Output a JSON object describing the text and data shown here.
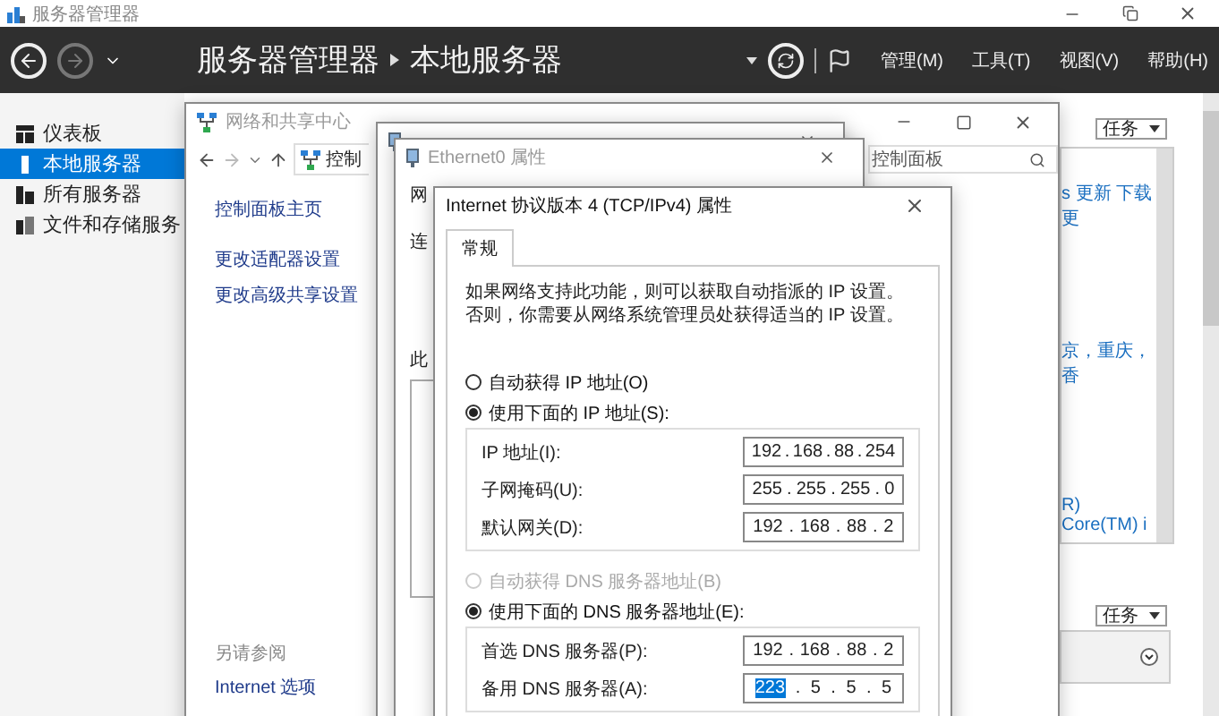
{
  "title_bar": {
    "title": "服务器管理器"
  },
  "header": {
    "breadcrumb": [
      "服务器管理器",
      "本地服务器"
    ],
    "menu": [
      "管理(M)",
      "工具(T)",
      "视图(V)",
      "帮助(H)"
    ]
  },
  "sidebar": {
    "items": [
      {
        "label": "仪表板",
        "selected": false
      },
      {
        "label": "本地服务器",
        "selected": true
      },
      {
        "label": "所有服务器",
        "selected": false
      },
      {
        "label": "文件和存储服务",
        "selected": false
      }
    ]
  },
  "background_panel": {
    "tasks_label": "任务",
    "lines": [
      "s 更新 下载更",
      "京，重庆，香",
      "R) Core(TM) i"
    ],
    "tasks_label_2": "任务"
  },
  "network_window": {
    "title": "网络和共享中心",
    "address": "控制",
    "search": "控制面板",
    "links": [
      "控制面板主页",
      "更改适配器设置",
      "更改高级共享设置"
    ],
    "see_also_heading": "另请参阅",
    "see_also": [
      "Internet 选项"
    ]
  },
  "ethernet_properties_window": {
    "title": "Ethernet0 属性",
    "fragments": [
      "网",
      "连",
      "此"
    ]
  },
  "ipv4_dialog": {
    "title": "Internet 协议版本 4 (TCP/IPv4) 属性",
    "separator": ".",
    "tabs": [
      {
        "label": "常规",
        "selected": true
      }
    ],
    "description": "如果网络支持此功能，则可以获取自动指派的 IP 设置。否则，你需要从网络系统管理员处获得适当的 IP 设置。",
    "ip_options": [
      {
        "label": "自动获得 IP 地址(O)",
        "selected": false,
        "disabled": false
      },
      {
        "label": "使用下面的 IP 地址(S):",
        "selected": true,
        "disabled": false
      }
    ],
    "ip_fields": [
      {
        "label": "IP 地址(I):",
        "octets": [
          {
            "text": "192",
            "selected": false
          },
          {
            "text": "168",
            "selected": false
          },
          {
            "text": "88",
            "selected": false
          },
          {
            "text": "254",
            "selected": false
          }
        ]
      },
      {
        "label": "子网掩码(U):",
        "octets": [
          {
            "text": "255",
            "selected": false
          },
          {
            "text": "255",
            "selected": false
          },
          {
            "text": "255",
            "selected": false
          },
          {
            "text": "0",
            "selected": false
          }
        ]
      },
      {
        "label": "默认网关(D):",
        "octets": [
          {
            "text": "192",
            "selected": false
          },
          {
            "text": "168",
            "selected": false
          },
          {
            "text": "88",
            "selected": false
          },
          {
            "text": "2",
            "selected": false
          }
        ]
      }
    ],
    "dns_options": [
      {
        "label": "自动获得 DNS 服务器地址(B)",
        "selected": false,
        "disabled": true
      },
      {
        "label": "使用下面的 DNS 服务器地址(E):",
        "selected": true,
        "disabled": false
      }
    ],
    "dns_fields": [
      {
        "label": "首选 DNS 服务器(P):",
        "octets": [
          {
            "text": "192",
            "selected": false
          },
          {
            "text": "168",
            "selected": false
          },
          {
            "text": "88",
            "selected": false
          },
          {
            "text": "2",
            "selected": false
          }
        ]
      },
      {
        "label": "备用 DNS 服务器(A):",
        "octets": [
          {
            "text": "223",
            "selected": true
          },
          {
            "text": "5",
            "selected": false
          },
          {
            "text": "5",
            "selected": false
          },
          {
            "text": "5",
            "selected": false
          }
        ]
      }
    ]
  }
}
